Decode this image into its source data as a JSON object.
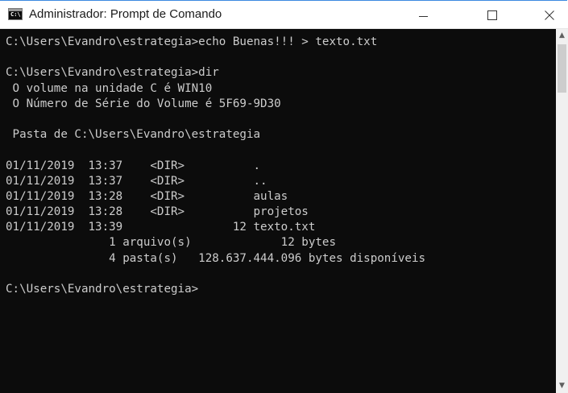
{
  "window": {
    "title": "Administrador: Prompt de Comando",
    "icon": "cmd-icon",
    "icon_text": "C:\\",
    "controls": {
      "minimize": "minimize-icon",
      "maximize": "maximize-icon",
      "close": "close-icon"
    }
  },
  "console": {
    "lines": [
      "C:\\Users\\Evandro\\estrategia>echo Buenas!!! > texto.txt",
      "",
      "C:\\Users\\Evandro\\estrategia>dir",
      " O volume na unidade C é WIN10",
      " O Número de Série do Volume é 5F69-9D30",
      "",
      " Pasta de C:\\Users\\Evandro\\estrategia",
      "",
      "01/11/2019  13:37    <DIR>          .",
      "01/11/2019  13:37    <DIR>          ..",
      "01/11/2019  13:28    <DIR>          aulas",
      "01/11/2019  13:28    <DIR>          projetos",
      "01/11/2019  13:39                12 texto.txt",
      "               1 arquivo(s)             12 bytes",
      "               4 pasta(s)   128.637.444.096 bytes disponíveis",
      "",
      "C:\\Users\\Evandro\\estrategia>"
    ]
  },
  "colors": {
    "console_bg": "#0c0c0c",
    "console_fg": "#cccccc",
    "titlebar_bg": "#ffffff",
    "window_border": "#3c8ae0"
  }
}
